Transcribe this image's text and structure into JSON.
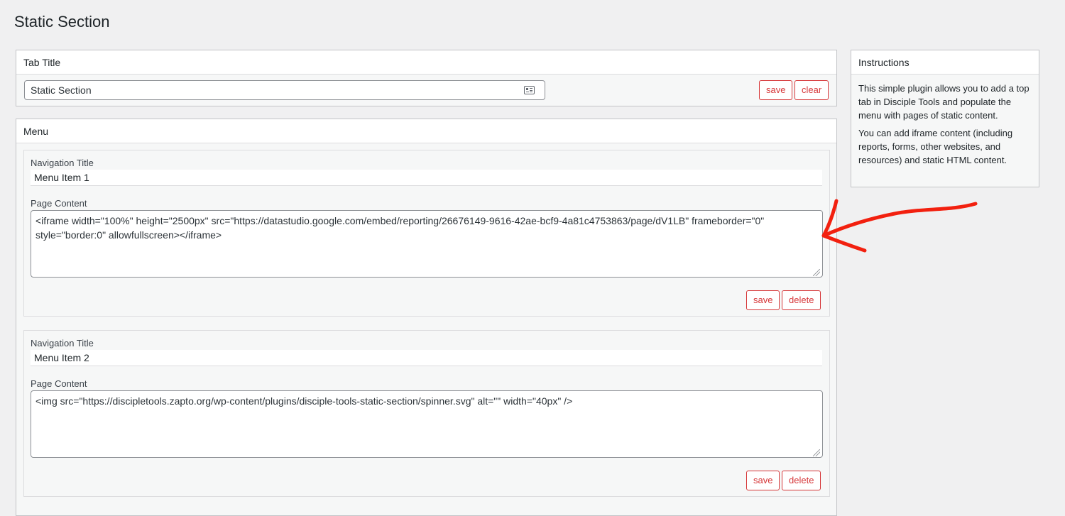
{
  "page": {
    "title": "Static Section"
  },
  "tab_title": {
    "header": "Tab Title",
    "input_value": "Static Section",
    "save_label": "save",
    "clear_label": "clear"
  },
  "menu": {
    "header": "Menu",
    "items": [
      {
        "nav_label": "Navigation Title",
        "nav_value": "Menu Item 1",
        "content_label": "Page Content",
        "content_value": "<iframe width=\"100%\" height=\"2500px\" src=\"https://datastudio.google.com/embed/reporting/26676149-9616-42ae-bcf9-4a81c4753863/page/dV1LB\" frameborder=\"0\" style=\"border:0\" allowfullscreen></iframe>",
        "save_label": "save",
        "delete_label": "delete"
      },
      {
        "nav_label": "Navigation Title",
        "nav_value": "Menu Item 2",
        "content_label": "Page Content",
        "content_value": "<img src=\"https://discipletools.zapto.org/wp-content/plugins/disciple-tools-static-section/spinner.svg\" alt=\"\" width=\"40px\" />",
        "save_label": "save",
        "delete_label": "delete"
      }
    ]
  },
  "instructions": {
    "header": "Instructions",
    "paragraphs": [
      "This simple plugin allows you to add a top tab in Disciple Tools and populate the menu with pages of static content.",
      "You can add iframe content (including reports, forms, other websites, and resources) and static HTML content."
    ]
  },
  "colors": {
    "background": "#f0f0f1",
    "accent_red": "#d63638",
    "annotation_arrow": "#f2200f"
  },
  "icons": {
    "tab_input": "contact-card-icon",
    "annotation": "red-arrow-annotation"
  }
}
